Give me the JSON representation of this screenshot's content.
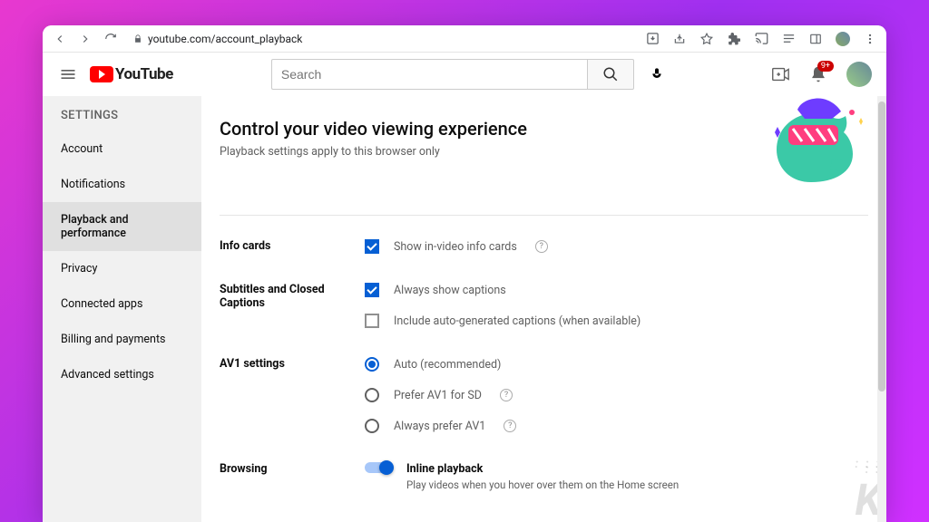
{
  "browser": {
    "url": "youtube.com/account_playback"
  },
  "header": {
    "logo_text": "YouTube",
    "search_placeholder": "Search",
    "notification_count": "9+"
  },
  "sidebar": {
    "title": "SETTINGS",
    "items": [
      {
        "label": "Account",
        "active": false
      },
      {
        "label": "Notifications",
        "active": false
      },
      {
        "label": "Playback and performance",
        "active": true
      },
      {
        "label": "Privacy",
        "active": false
      },
      {
        "label": "Connected apps",
        "active": false
      },
      {
        "label": "Billing and payments",
        "active": false
      },
      {
        "label": "Advanced settings",
        "active": false
      }
    ]
  },
  "page": {
    "title": "Control your video viewing experience",
    "subtitle": "Playback settings apply to this browser only"
  },
  "sections": {
    "info_cards": {
      "heading": "Info cards",
      "opt1_label": "Show in-video info cards",
      "opt1_checked": true
    },
    "captions": {
      "heading": "Subtitles and Closed Captions",
      "opt1_label": "Always show captions",
      "opt1_checked": true,
      "opt2_label": "Include auto-generated captions (when available)",
      "opt2_checked": false
    },
    "av1": {
      "heading": "AV1 settings",
      "options": [
        {
          "label": "Auto (recommended)",
          "checked": true,
          "help": false
        },
        {
          "label": "Prefer AV1 for SD",
          "checked": false,
          "help": true
        },
        {
          "label": "Always prefer AV1",
          "checked": false,
          "help": true
        }
      ]
    },
    "browsing": {
      "heading": "Browsing",
      "toggle_title": "Inline playback",
      "toggle_sub": "Play videos when you hover over them on the Home screen",
      "toggle_on": true
    }
  }
}
